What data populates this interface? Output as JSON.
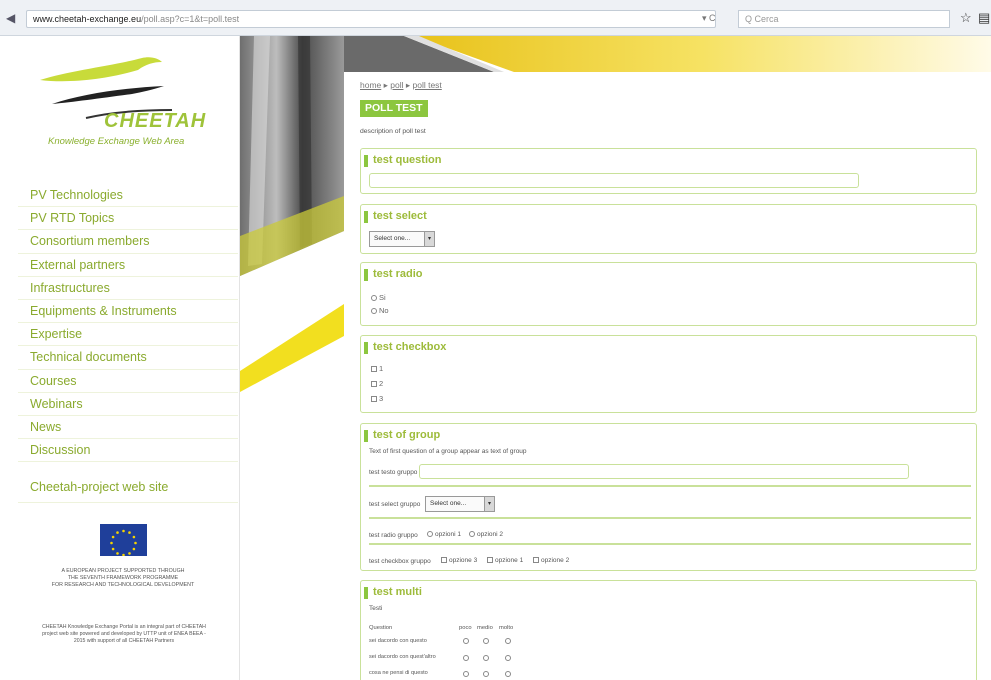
{
  "browser": {
    "url_host": "www.cheetah-exchange.eu",
    "url_path": "/poll.asp?c=1&t=poll.test",
    "search_placeholder": "Q Cerca",
    "refresh": "▾ C"
  },
  "logo": {
    "name": "CHEETAH",
    "tagline": "Knowledge Exchange Web Area"
  },
  "sidebar": {
    "items": [
      {
        "label": "PV Technologies"
      },
      {
        "label": "PV RTD Topics"
      },
      {
        "label": "Consortium members"
      },
      {
        "label": "External partners"
      },
      {
        "label": "Infrastructures"
      },
      {
        "label": "Equipments & Instruments"
      },
      {
        "label": "Expertise"
      },
      {
        "label": "Technical documents"
      },
      {
        "label": "Courses"
      },
      {
        "label": "Webinars"
      },
      {
        "label": "News"
      },
      {
        "label": "Discussion"
      }
    ],
    "project_link": "Cheetah-project web site",
    "eu_text_1": "A European project supported through",
    "eu_text_2": "the Seventh Framework Programme",
    "eu_text_3": "for research and technological development",
    "footer_1": "CHEETAH Knowledge Exchange Portal is an integral part of CHEETAH",
    "footer_2": "project web site powered and developed by UTTP unit of ENEA BEEA -",
    "footer_3": "2015 with support of all CHEETAH Partners"
  },
  "colors": {
    "accent": "#8cc63f",
    "link": "#8aaa2e",
    "border": "#c9e19a",
    "yellow": "#f2df1f"
  },
  "main": {
    "breadcrumb": [
      "home",
      "poll",
      "poll test"
    ],
    "title": "POLL TEST",
    "description": "description of poll test",
    "q1": {
      "title": "test question"
    },
    "q2": {
      "title": "test select",
      "select_value": "Select one..."
    },
    "q3": {
      "title": "test radio",
      "options": [
        "Si",
        "No"
      ]
    },
    "q4": {
      "title": "test checkbox",
      "options": [
        "1",
        "2",
        "3"
      ]
    },
    "q5": {
      "title": "test of group",
      "description": "Text of first question of a group appear as text of group",
      "text_label": "test testo gruppo",
      "select_label": "test select gruppo",
      "select_value": "Select one...",
      "radio_label": "test radio gruppo",
      "radio_options": [
        "opzioni 1",
        "opzioni 2"
      ],
      "check_label": "test checkbox gruppo",
      "check_options": [
        "opzione 3",
        "opzione 1",
        "opzione 2"
      ]
    },
    "q6": {
      "title": "test multi",
      "text": "Testi",
      "question_header": "Question",
      "columns": [
        "poco",
        "medio",
        "molto"
      ],
      "rows": [
        "sei dacordo con questo",
        "sei dacordo con quest'altro",
        "cosa ne pensi di questo"
      ]
    }
  }
}
